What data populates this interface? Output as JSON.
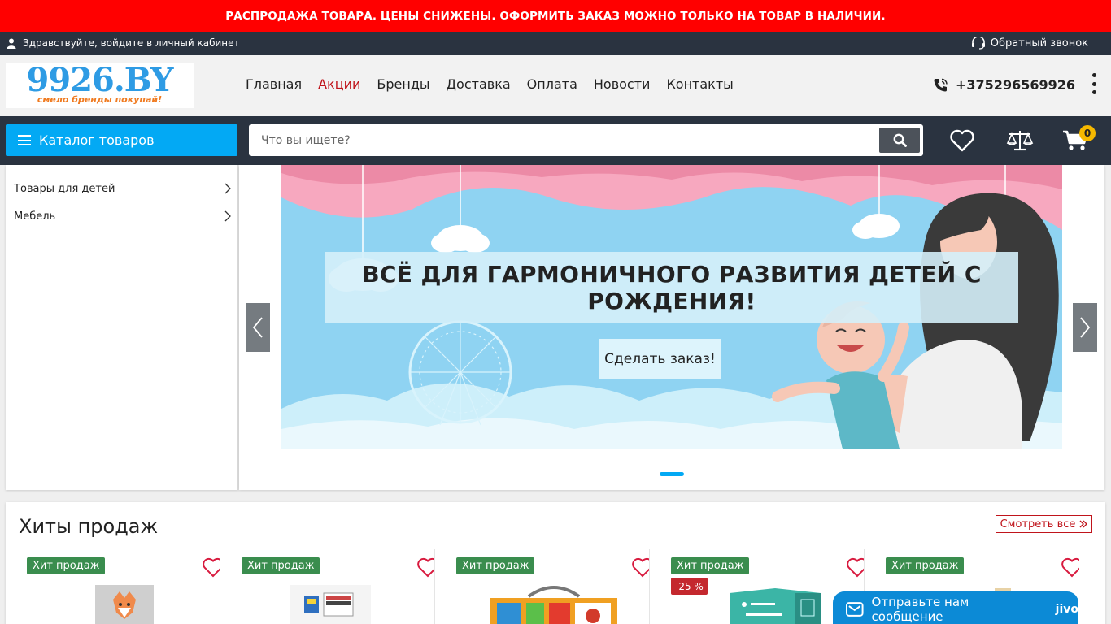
{
  "promo": {
    "text": "РАСПРОДАЖА ТОВАРА. ЦЕНЫ СНИЖЕНЫ. ОФОРМИТЬ ЗАКАЗ МОЖНО ТОЛЬКО НА ТОВАР В НАЛИЧИИ."
  },
  "topbar": {
    "greeting": "Здравствуйте,",
    "login_link": "войдите в личный кабинет",
    "callback": "Обратный звонок"
  },
  "header": {
    "logo_text": "9926.BY",
    "logo_tagline": "смело бренды покупай!",
    "nav": [
      "Главная",
      "Акции",
      "Бренды",
      "Доставка",
      "Оплата",
      "Новости",
      "Контакты"
    ],
    "phone": "+375296569926"
  },
  "search": {
    "catalog_label": "Каталог товаров",
    "placeholder": "Что вы ищете?",
    "cart_count": "0"
  },
  "categories": [
    "Товары для детей",
    "Мебель"
  ],
  "slider": {
    "title": "ВСЁ ДЛЯ ГАРМОНИЧНОГО РАЗВИТИЯ ДЕТЕЙ С РОЖДЕНИЯ!",
    "button": "Сделать заказ!"
  },
  "hits": {
    "title": "Хиты продаж",
    "see_all": "Смотреть все",
    "products": [
      {
        "badge": "Хит продаж",
        "discount": ""
      },
      {
        "badge": "Хит продаж",
        "discount": ""
      },
      {
        "badge": "Хит продаж",
        "discount": ""
      },
      {
        "badge": "Хит продаж",
        "discount": "-25 %"
      },
      {
        "badge": "Хит продаж",
        "discount": ""
      }
    ]
  },
  "chat": {
    "label": "Отправьте нам сообщение",
    "brand": "jivo"
  },
  "colors": {
    "promo": "#ff0000",
    "dark": "#2a3340",
    "accent": "#03a9f4",
    "hit_badge": "#3a8d4e",
    "discount": "#c4282e"
  }
}
